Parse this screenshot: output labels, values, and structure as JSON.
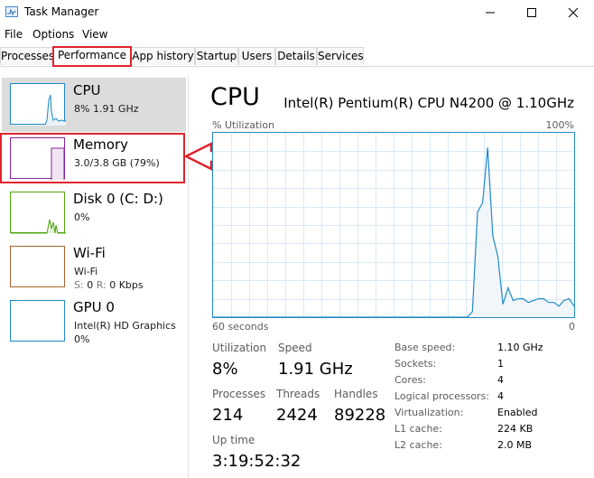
{
  "window": {
    "title": "Task Manager"
  },
  "menu": [
    "File",
    "Options",
    "View"
  ],
  "tabs": [
    "Processes",
    "Performance",
    "App history",
    "Startup",
    "Users",
    "Details",
    "Services"
  ],
  "active_tab": "Performance",
  "sidebar": {
    "items": [
      {
        "name": "CPU",
        "sub1": "8% 1.91 GHz",
        "color": "#1f8ac6",
        "selected": true
      },
      {
        "name": "Memory",
        "sub1": "3.0/3.8 GB (79%)",
        "color": "#8b1fa0",
        "highlighted": true
      },
      {
        "name": "Disk 0 (C: D:)",
        "sub1": "0%",
        "color": "#4da60c"
      },
      {
        "name": "Wi-Fi",
        "sub1": "Wi-Fi",
        "sub2_s": "S:",
        "sub2_s_val": "0",
        "sub2_r": "R:",
        "sub2_r_val": "0 Kbps",
        "color": "#a7642d"
      },
      {
        "name": "GPU 0",
        "sub1": "Intel(R) HD Graphics",
        "sub2": "0%",
        "color": "#1f8ac6"
      }
    ]
  },
  "main": {
    "title": "CPU",
    "model": "Intel(R) Pentium(R) CPU N4200 @ 1.10GHz",
    "graph": {
      "top_left_label": "% Utilization",
      "top_right_label": "100%",
      "bottom_left_label": "60 seconds",
      "bottom_right_label": "0",
      "line_color": "#1f8ac6",
      "fill_color": "#f1f6fb",
      "grid_color": "#d9eaf7",
      "utilization_series": [
        0,
        0,
        0,
        0,
        0,
        0,
        0,
        0,
        0,
        0,
        0,
        0,
        0,
        0,
        0,
        0,
        0,
        0,
        0,
        0,
        0,
        0,
        0,
        0,
        0,
        0,
        0,
        0,
        0,
        0,
        0,
        0,
        0,
        0,
        0,
        0,
        0,
        0,
        0,
        0,
        0,
        0,
        0,
        0,
        0,
        0,
        0,
        0,
        0,
        0,
        0,
        3,
        57,
        62,
        92,
        44,
        33,
        7,
        16,
        9,
        10,
        10,
        8,
        9,
        10,
        10,
        8,
        8,
        6,
        9,
        10,
        6
      ]
    },
    "stats": {
      "utilization_label": "Utilization",
      "utilization_value": "8%",
      "speed_label": "Speed",
      "speed_value": "1.91 GHz",
      "processes_label": "Processes",
      "processes_value": "214",
      "threads_label": "Threads",
      "threads_value": "2424",
      "handles_label": "Handles",
      "handles_value": "89228",
      "uptime_label": "Up time",
      "uptime_value": "3:19:52:32"
    },
    "specs": [
      {
        "label": "Base speed:",
        "value": "1.10 GHz"
      },
      {
        "label": "Sockets:",
        "value": "1"
      },
      {
        "label": "Cores:",
        "value": "4"
      },
      {
        "label": "Logical processors:",
        "value": "4"
      },
      {
        "label": "Virtualization:",
        "value": "Enabled"
      },
      {
        "label": "L1 cache:",
        "value": "224 KB"
      },
      {
        "label": "L2 cache:",
        "value": "2.0 MB"
      }
    ]
  },
  "annotation_color": "#e0232e"
}
